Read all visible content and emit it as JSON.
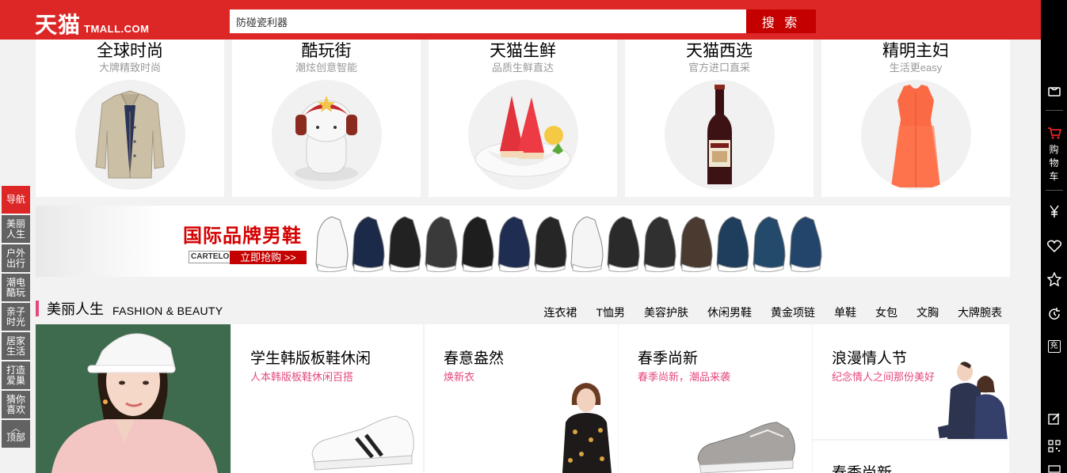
{
  "header": {
    "logo_cn": "天猫",
    "logo_en": "TMALL.COM",
    "search_value": "防碰瓷利器",
    "search_button": "搜 索"
  },
  "right_sidebar": {
    "cart_chars": [
      "购",
      "物",
      "车"
    ],
    "icons": [
      "bag-icon",
      "cart-icon",
      "yen-icon",
      "heart-icon",
      "star-icon",
      "history-icon",
      "recharge-icon",
      "feedback-icon",
      "qrcode-icon"
    ],
    "recharge_label": "充"
  },
  "left_nav": {
    "items": [
      "导航",
      "美丽人生",
      "户外出行",
      "潮电酷玩",
      "亲子时光",
      "居家生活",
      "打造爱巢",
      "猜你喜欢"
    ],
    "top_label": "顶部"
  },
  "categories": [
    {
      "title": "全球时尚",
      "subtitle": "大牌精致时尚"
    },
    {
      "title": "酷玩街",
      "subtitle": "潮炫创意智能"
    },
    {
      "title": "天猫生鲜",
      "subtitle": "品质生鲜直达"
    },
    {
      "title": "天猫西选",
      "subtitle": "官方进口直采"
    },
    {
      "title": "精明主妇",
      "subtitle": "生活更easy"
    }
  ],
  "banner": {
    "title": "国际品牌男鞋",
    "brand": "CARTELO",
    "cta": "立即抢购 >>"
  },
  "section": {
    "title": "美丽人生",
    "title_en": "FASHION & BEAUTY",
    "tags": [
      "连衣裙",
      "T恤男",
      "美容护肤",
      "休闲男鞋",
      "黄金项链",
      "单鞋",
      "女包",
      "文胸",
      "大牌腕表"
    ]
  },
  "products": [
    {
      "title": "学生韩版板鞋休闲",
      "subtitle": "人本韩版板鞋休闲百搭"
    },
    {
      "title": "春意盎然",
      "subtitle": "焕新衣"
    },
    {
      "title": "春季尚新",
      "subtitle": "春季尚新，潮品来袭"
    },
    {
      "title": "浪漫情人节",
      "subtitle": "纪念情人之间那份美好"
    },
    {
      "title": "春季尚新",
      "subtitle": ""
    }
  ],
  "colors": {
    "brand_red": "#dd2727",
    "dark_red": "#c40000",
    "pink_accent": "#e5487a",
    "nav_gray": "#626262"
  }
}
